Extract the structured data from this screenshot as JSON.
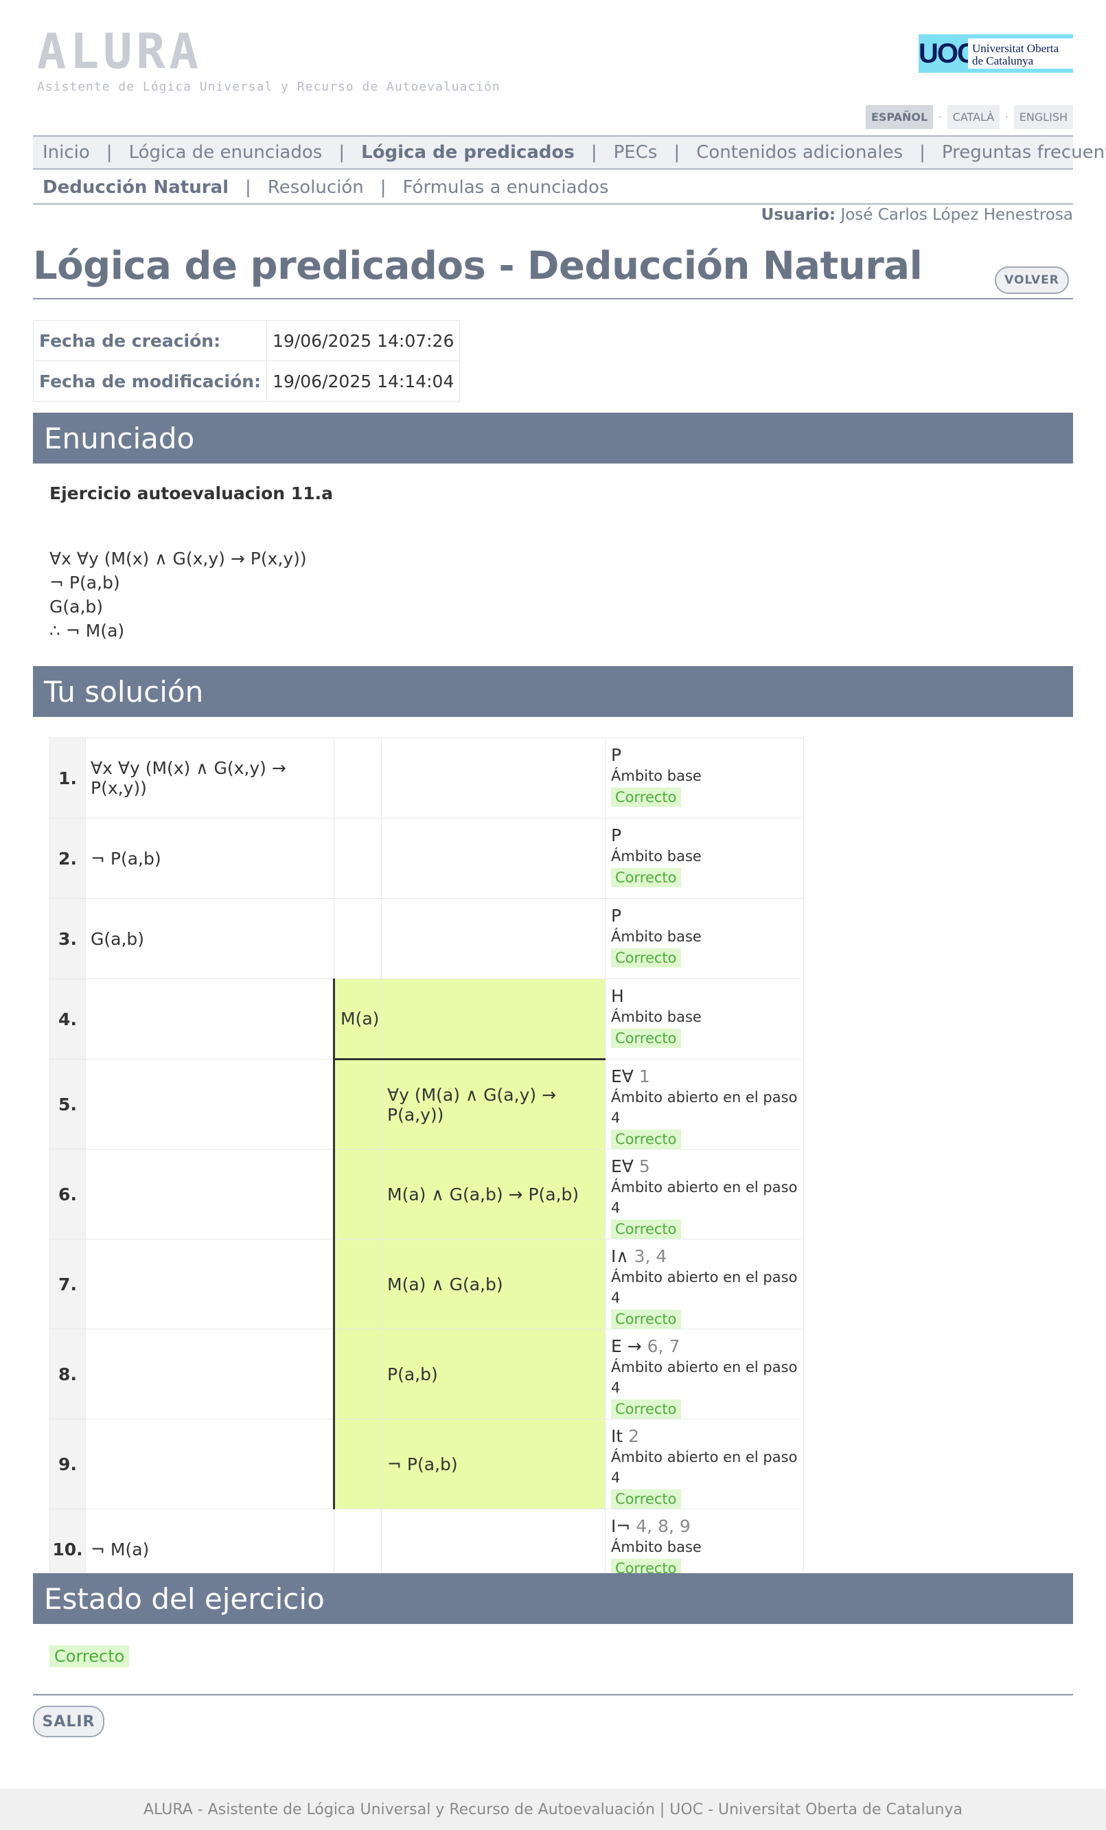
{
  "header": {
    "logo_text": "ALURA",
    "logo_subtitle": "Asistente de Lógica Universal y Recurso de Autoevaluación",
    "uoc_mark": "UOC",
    "uoc_name_line1": "Universitat Oberta",
    "uoc_name_line2": "de Catalunya"
  },
  "languages": [
    {
      "label": "ESPAÑOL",
      "active": true
    },
    {
      "label": "CATALÀ",
      "active": false
    },
    {
      "label": "ENGLISH",
      "active": false
    }
  ],
  "nav_main": [
    "Inicio",
    "Lógica de enunciados",
    "Lógica de predicados",
    "PECs",
    "Contenidos adicionales",
    "Preguntas frecuentes"
  ],
  "nav_sub": [
    "Deducción Natural",
    "Resolución",
    "Fórmulas a enunciados"
  ],
  "user": {
    "label": "Usuario:",
    "name": "José Carlos López Henestrosa"
  },
  "page_title": "Lógica de predicados - Deducción Natural",
  "volver_label": "VOLVER",
  "meta": {
    "created_label": "Fecha de creación:",
    "created_value": "19/06/2025 14:07:26",
    "modified_label": "Fecha de modificación:",
    "modified_value": "19/06/2025 14:14:04"
  },
  "section_enunciado": "Enunciado",
  "exercise_title": "Ejercicio autoevaluacion 11.a",
  "premises": [
    "∀x ∀y (M(x) ∧ G(x,y) → P(x,y))",
    "¬ P(a,b)",
    "G(a,b)",
    "∴ ¬ M(a)"
  ],
  "section_solucion": "Tu solución",
  "proof_rows": [
    {
      "n": "1.",
      "c1": "∀x ∀y (M(x) ∧ G(x,y) → P(x,y))",
      "c2": "",
      "c3": "",
      "rule": "P",
      "refs": "",
      "scope": "Ámbito base",
      "status": "Correcto"
    },
    {
      "n": "2.",
      "c1": "¬ P(a,b)",
      "c2": "",
      "c3": "",
      "rule": "P",
      "refs": "",
      "scope": "Ámbito base",
      "status": "Correcto"
    },
    {
      "n": "3.",
      "c1": "G(a,b)",
      "c2": "",
      "c3": "",
      "rule": "P",
      "refs": "",
      "scope": "Ámbito base",
      "status": "Correcto"
    },
    {
      "n": "4.",
      "c1": "",
      "c2": "M(a)",
      "c3": "",
      "rule": "H",
      "refs": "",
      "scope": "Ámbito base",
      "status": "Correcto"
    },
    {
      "n": "5.",
      "c1": "",
      "c2": "",
      "c3": "∀y (M(a) ∧ G(a,y) → P(a,y))",
      "rule": "E∀",
      "refs": "1",
      "scope": "Ámbito abierto en el paso 4",
      "status": "Correcto"
    },
    {
      "n": "6.",
      "c1": "",
      "c2": "",
      "c3": "M(a) ∧ G(a,b) → P(a,b)",
      "rule": "E∀",
      "refs": "5",
      "scope": "Ámbito abierto en el paso 4",
      "status": "Correcto"
    },
    {
      "n": "7.",
      "c1": "",
      "c2": "",
      "c3": "M(a) ∧ G(a,b)",
      "rule": "I∧",
      "refs": "3, 4",
      "scope": "Ámbito abierto en el paso 4",
      "status": "Correcto"
    },
    {
      "n": "8.",
      "c1": "",
      "c2": "",
      "c3": "P(a,b)",
      "rule": "E →",
      "refs": "6, 7",
      "scope": "Ámbito abierto en el paso 4",
      "status": "Correcto"
    },
    {
      "n": "9.",
      "c1": "",
      "c2": "",
      "c3": "¬ P(a,b)",
      "rule": "It",
      "refs": "2",
      "scope": "Ámbito abierto en el paso 4",
      "status": "Correcto"
    },
    {
      "n": "10.",
      "c1": "¬ M(a)",
      "c2": "",
      "c3": "",
      "rule": "I¬",
      "refs": "4, 8, 9",
      "scope": "Ámbito base",
      "status": "Correcto"
    }
  ],
  "section_estado": "Estado del ejercicio",
  "estado_value": "Correcto",
  "salir_label": "SALIR",
  "footer": "ALURA - Asistente de Lógica Universal y Recurso de Autoevaluación | UOC - Universitat Oberta de Catalunya",
  "colors": {
    "bar": "#6e7c94",
    "highlight": "#eafba8",
    "correct_bg": "#dff7cf",
    "correct_text": "#4cae3c"
  }
}
